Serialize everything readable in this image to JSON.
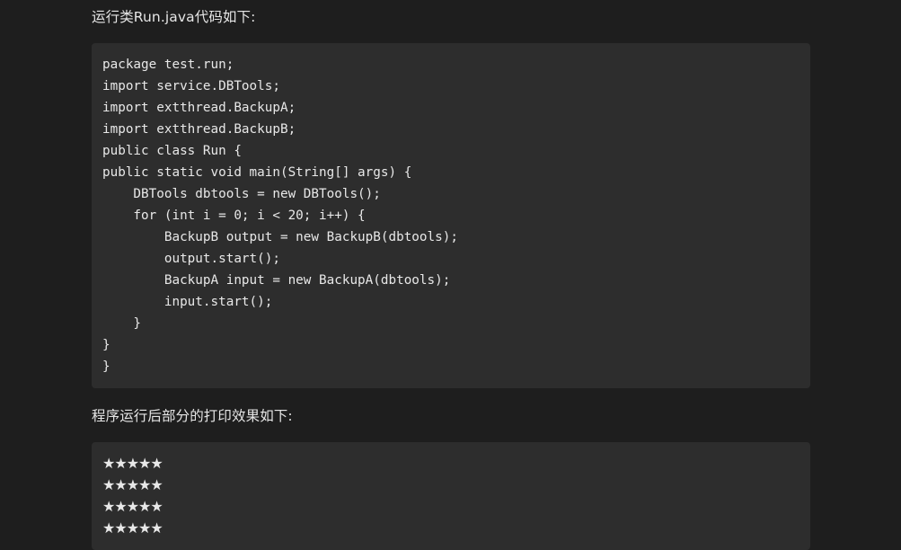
{
  "paragraphs": {
    "intro": "运行类Run.java代码如下:",
    "output_intro": "程序运行后部分的打印效果如下:"
  },
  "code_block": {
    "lines": [
      "package test.run;",
      "import service.DBTools;",
      "import extthread.BackupA;",
      "import extthread.BackupB;",
      "public class Run {",
      "public static void main(String[] args) {",
      "    DBTools dbtools = new DBTools();",
      "    for (int i = 0; i < 20; i++) {",
      "        BackupB output = new BackupB(dbtools);",
      "        output.start();",
      "        BackupA input = new BackupA(dbtools);",
      "        input.start();",
      "    }",
      "}",
      "}"
    ]
  },
  "output_block": {
    "lines": [
      "★★★★★",
      "★★★★★",
      "★★★★★",
      "★★★★★"
    ]
  },
  "colors": {
    "page_background": "#1e1e1e",
    "code_background": "#2d2d2d",
    "text": "#e6e6e6"
  }
}
